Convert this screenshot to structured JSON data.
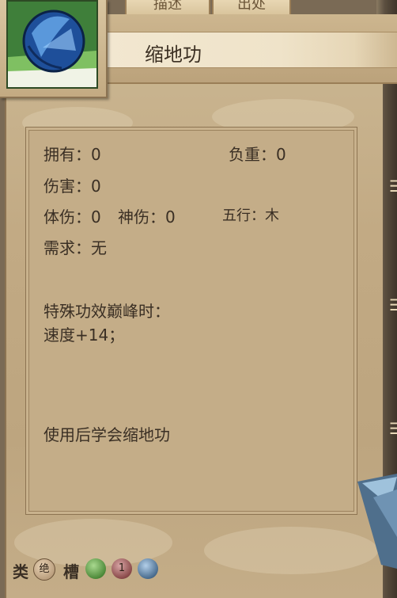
{
  "tabs": [
    "描述",
    "出处"
  ],
  "item": {
    "title": "缩地功"
  },
  "stats": {
    "own_label": "拥有：0",
    "weight_label": "负重：0",
    "damage_label": "伤害：0",
    "body_dmg_label": "体伤：0",
    "spirit_dmg_label": "神伤：0",
    "element_label": "五行：木",
    "requirement_label": "需求：无"
  },
  "special": {
    "heading": "特殊功效巅峰时：",
    "effect": "速度+14；"
  },
  "usage": "使用后学会缩地功",
  "footer": {
    "category_label": "类",
    "category_value": "绝",
    "slot_label": "槽",
    "slot_number": "1"
  },
  "colors": {
    "parchment": "#c4ad88",
    "text": "#3a2f24",
    "gem_green": "#4e8a3a",
    "gem_red": "#8a4a4a",
    "gem_blue": "#4a6d8f"
  },
  "icons": [
    "blue-orb-icon",
    "green-gem-icon",
    "red-gem-icon",
    "blue-gem-icon"
  ]
}
